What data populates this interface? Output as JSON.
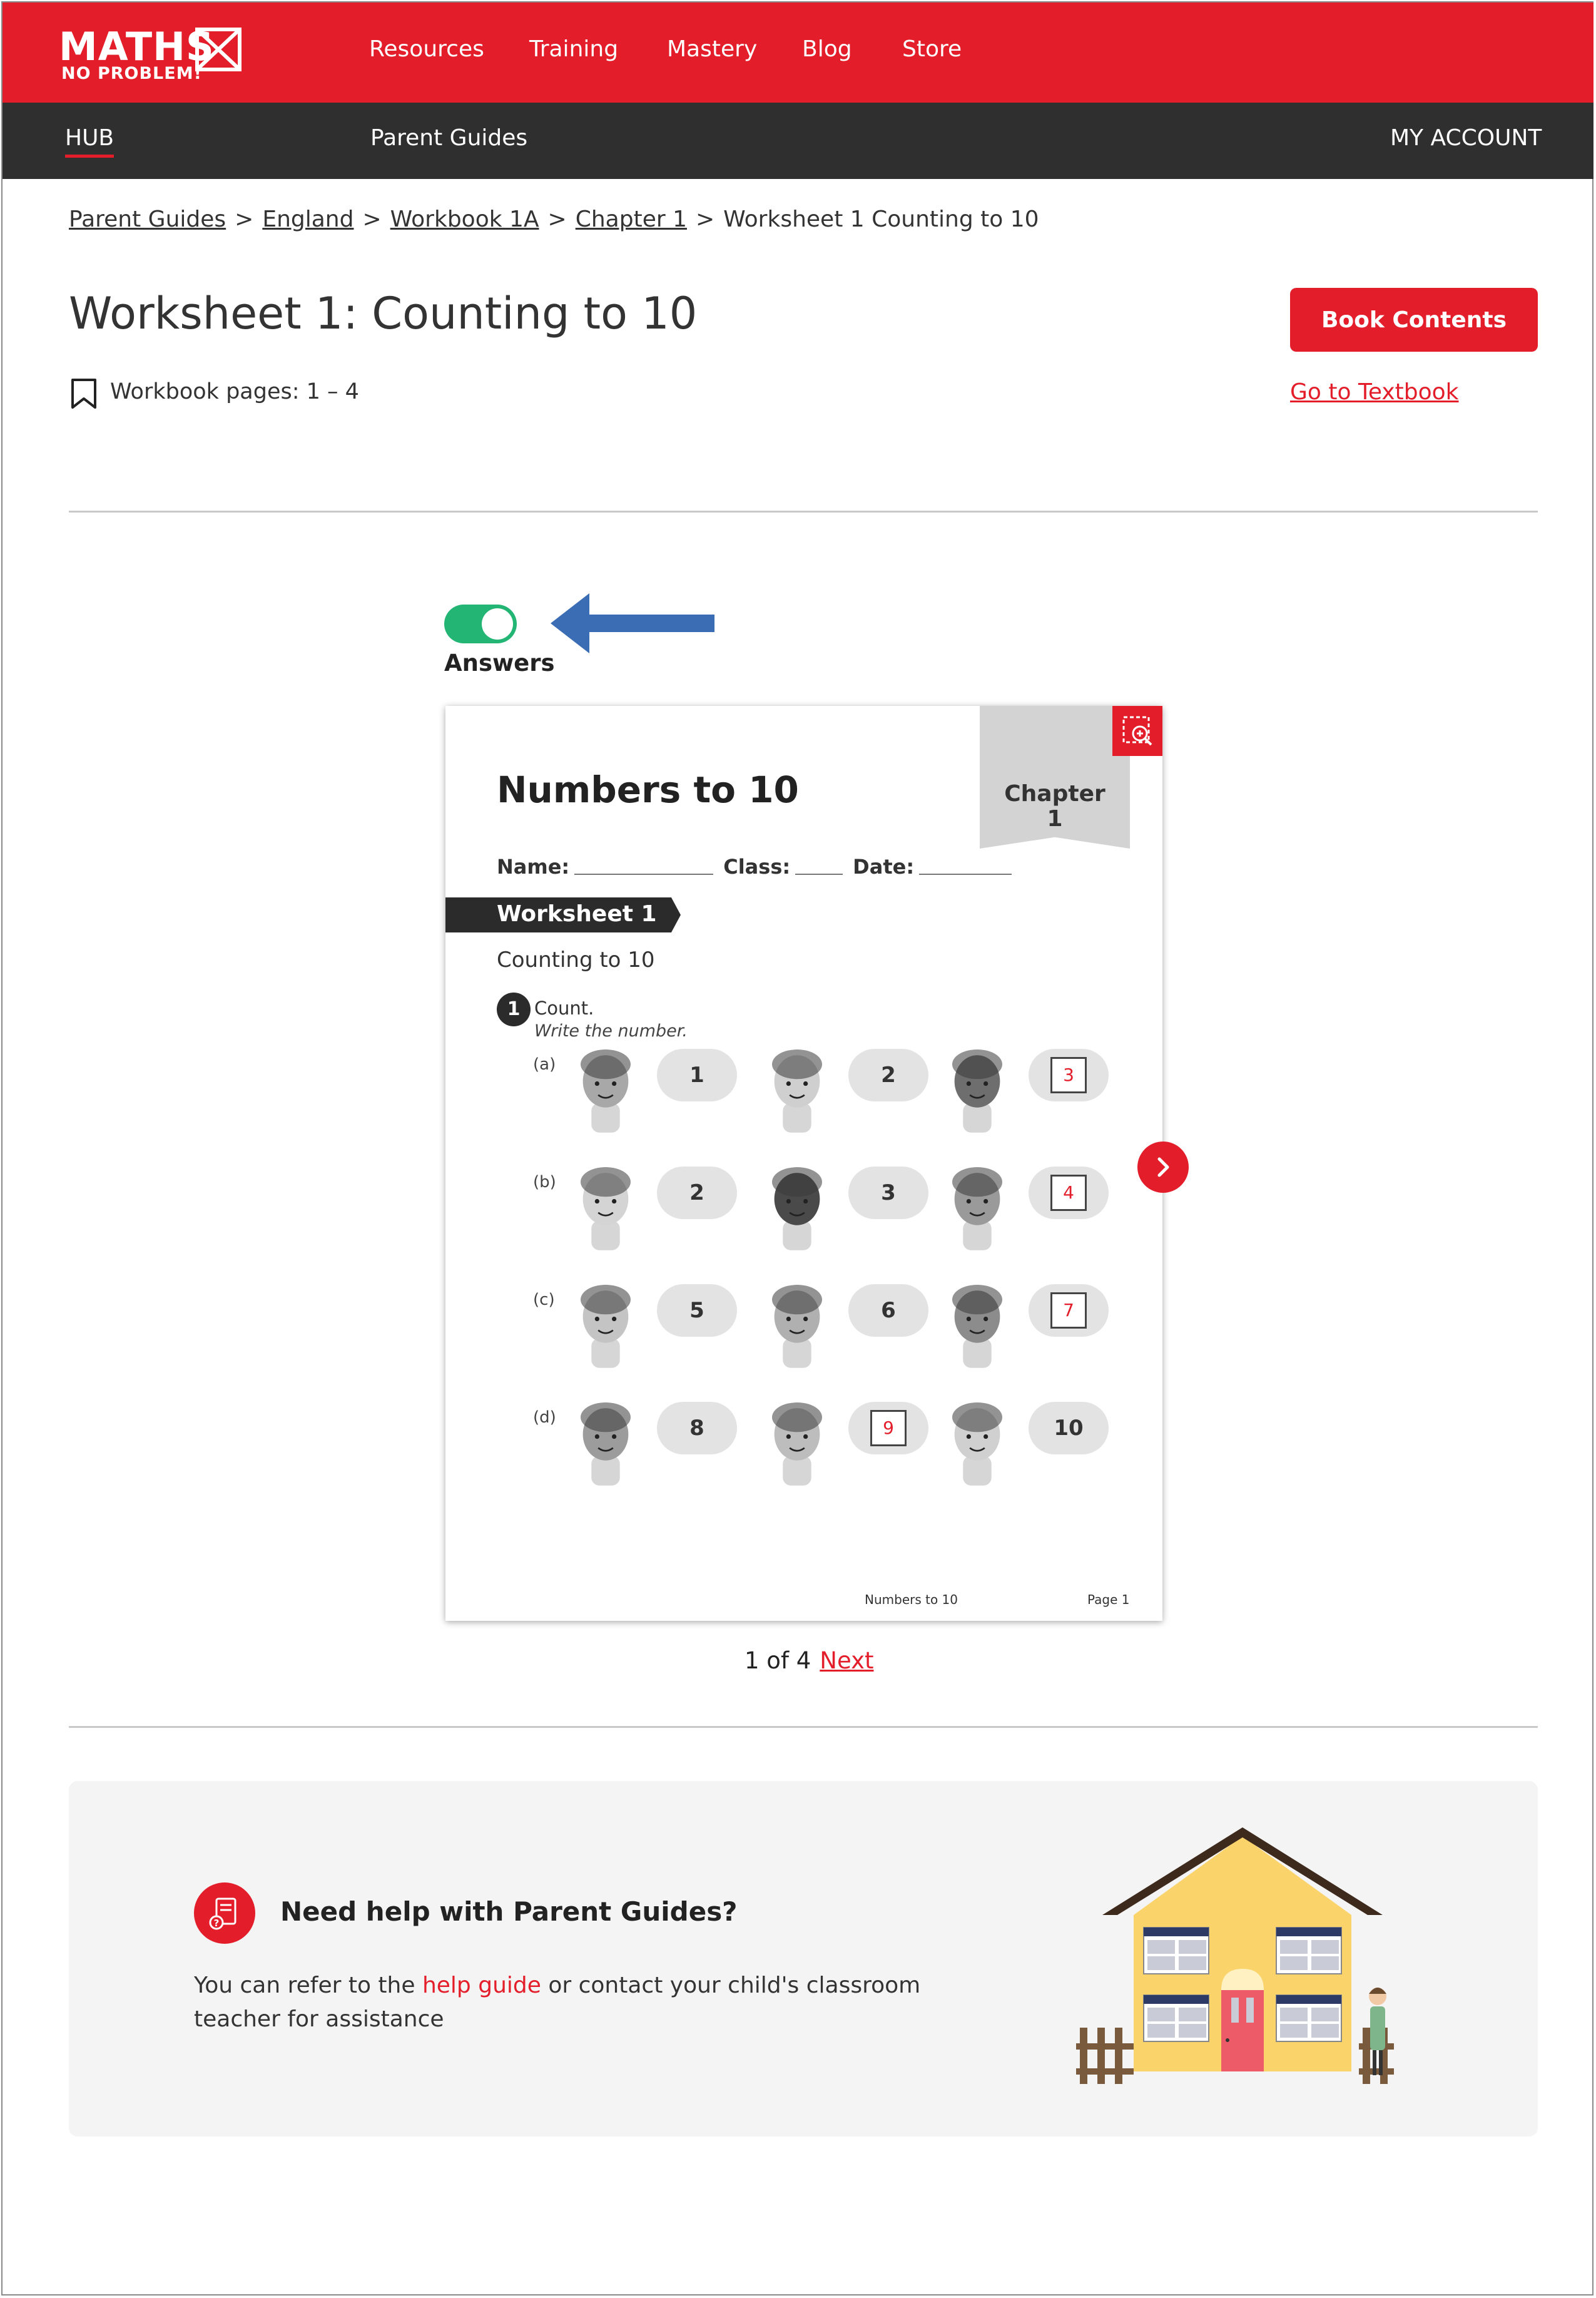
{
  "header": {
    "logo_line1": "MATHS",
    "logo_line2": "NO PROBLEM!",
    "nav": [
      "Resources",
      "Training",
      "Mastery",
      "Blog",
      "Store"
    ]
  },
  "subnav": {
    "hub": "HUB",
    "parent_guides": "Parent Guides",
    "account": "MY ACCOUNT"
  },
  "breadcrumb": {
    "links": [
      "Parent Guides",
      "England",
      "Workbook 1A",
      "Chapter 1"
    ],
    "separator": ">",
    "current": "Worksheet 1 Counting to 10"
  },
  "page": {
    "title": "Worksheet 1: Counting to 10",
    "workbook_pages": "Workbook pages: 1 – 4",
    "book_contents": "Book Contents",
    "go_to_textbook": "Go to Textbook"
  },
  "answers_toggle": {
    "label": "Answers",
    "on": true
  },
  "worksheet": {
    "title": "Numbers to 10",
    "chapter_word": "Chapter",
    "chapter_num": "1",
    "name_label": "Name:",
    "class_label": "Class:",
    "date_label": "Date:",
    "banner": "Worksheet 1",
    "subtitle": "Counting to 10",
    "question_number": "1",
    "instruction_1": "Count.",
    "instruction_2": "Write the number.",
    "rows": [
      {
        "label": "(a)",
        "cells": [
          {
            "value": "1",
            "answer": false
          },
          {
            "value": "2",
            "answer": false
          },
          {
            "value": "3",
            "answer": true
          }
        ]
      },
      {
        "label": "(b)",
        "cells": [
          {
            "value": "2",
            "answer": false
          },
          {
            "value": "3",
            "answer": false
          },
          {
            "value": "4",
            "answer": true
          }
        ]
      },
      {
        "label": "(c)",
        "cells": [
          {
            "value": "5",
            "answer": false
          },
          {
            "value": "6",
            "answer": false
          },
          {
            "value": "7",
            "answer": true
          }
        ]
      },
      {
        "label": "(d)",
        "cells": [
          {
            "value": "8",
            "answer": false
          },
          {
            "value": "9",
            "answer": true
          },
          {
            "value": "10",
            "answer": false
          }
        ]
      }
    ],
    "footer_title": "Numbers to 10",
    "footer_page": "Page 1"
  },
  "pagination": {
    "status": "1 of 4",
    "next": "Next"
  },
  "help": {
    "title": "Need help with Parent Guides?",
    "text_before": "You can refer to the ",
    "link": "help guide",
    "text_after": " or contact your child's classroom teacher for assistance"
  },
  "colors": {
    "brand_red": "#e31e2a",
    "dark_bar": "#2f2f2f",
    "toggle_green": "#22b573",
    "arrow_blue": "#3b6db5"
  },
  "icons": {
    "bookmark": "bookmark-icon",
    "zoom": "zoom-icon",
    "next": "chevron-right-icon",
    "help": "help-document-icon",
    "arrow": "arrow-left-icon"
  }
}
